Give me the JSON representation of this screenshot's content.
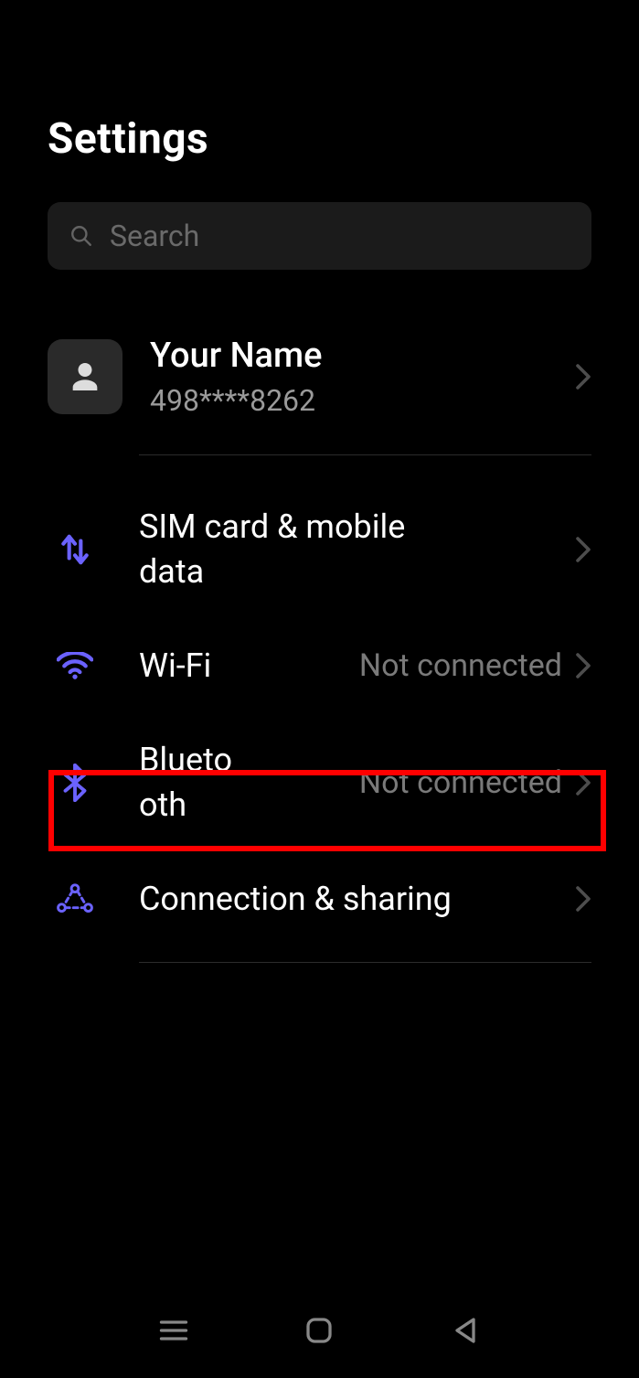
{
  "header": {
    "title": "Settings"
  },
  "search": {
    "placeholder": "Search"
  },
  "account": {
    "name": "Your Name",
    "phone_masked": "498****8262"
  },
  "rows": {
    "sim": {
      "label": "SIM card & mobile data"
    },
    "wifi": {
      "label": "Wi-Fi",
      "value": "Not connected"
    },
    "bluetooth": {
      "label": "Bluetooth",
      "value": "Not connected"
    },
    "sharing": {
      "label": "Connection & sharing"
    }
  },
  "colors": {
    "accent": "#6b62ff",
    "highlight": "#ff0000"
  }
}
